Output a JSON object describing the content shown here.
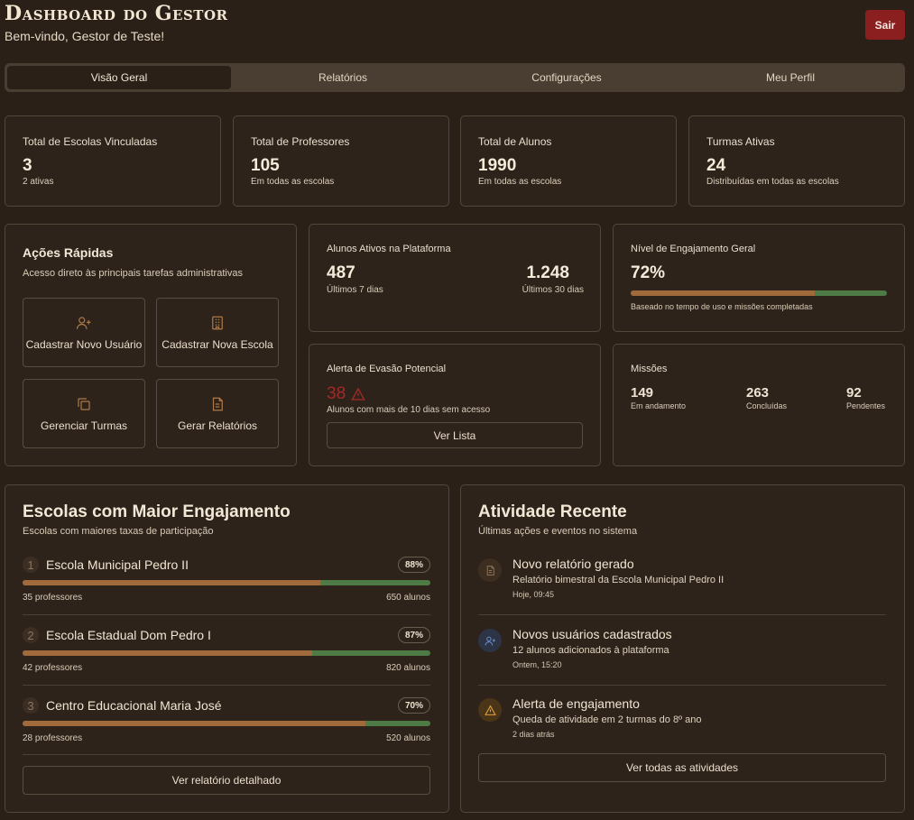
{
  "header": {
    "title": "Dashboard do Gestor",
    "subtitle": "Bem-vindo, Gestor de Teste!",
    "logout_label": "Sair"
  },
  "tabs": [
    {
      "label": "Visão Geral",
      "active": true
    },
    {
      "label": "Relatórios",
      "active": false
    },
    {
      "label": "Configurações",
      "active": false
    },
    {
      "label": "Meu Perfil",
      "active": false
    }
  ],
  "stats": [
    {
      "label": "Total de Escolas Vinculadas",
      "value": "3",
      "note": "2 ativas"
    },
    {
      "label": "Total de Professores",
      "value": "105",
      "note": "Em todas as escolas"
    },
    {
      "label": "Total de Alunos",
      "value": "1990",
      "note": "Em todas as escolas"
    },
    {
      "label": "Turmas Ativas",
      "value": "24",
      "note": "Distribuídas em todas as escolas"
    }
  ],
  "quick_actions": {
    "title": "Ações Rápidas",
    "subtitle": "Acesso direto às principais tarefas administrativas",
    "items": [
      {
        "label": "Cadastrar Novo Usuário",
        "icon": "user-plus-icon"
      },
      {
        "label": "Cadastrar Nova Escola",
        "icon": "building-icon"
      },
      {
        "label": "Gerenciar Turmas",
        "icon": "copy-icon"
      },
      {
        "label": "Gerar Relatórios",
        "icon": "document-icon"
      }
    ]
  },
  "active_students": {
    "title": "Alunos Ativos na Plataforma",
    "value_7": "487",
    "label_7": "Últimos 7 dias",
    "value_30": "1.248",
    "label_30": "Últimos 30 dias"
  },
  "engagement": {
    "title": "Nível de Engajamento Geral",
    "value": "72%",
    "level": 0.72,
    "note": "Baseado no tempo de uso e missões completadas"
  },
  "dropout": {
    "title": "Alerta de Evasão Potencial",
    "value": "38",
    "note": "Alunos com mais de 10 dias sem acesso",
    "button": "Ver Lista"
  },
  "missions": {
    "title": "Missões",
    "items": [
      {
        "value": "149",
        "label": "Em andamento"
      },
      {
        "value": "263",
        "label": "Concluídas"
      },
      {
        "value": "92",
        "label": "Pendentes"
      }
    ]
  },
  "top_schools": {
    "title": "Escolas com Maior Engajamento",
    "subtitle": "Escolas com maiores taxas de participação",
    "items": [
      {
        "rank": "1",
        "name": "Escola Municipal Pedro II",
        "pct": "88%",
        "level": 0.73,
        "teachers": "35 professores",
        "students": "650 alunos"
      },
      {
        "rank": "2",
        "name": "Escola Estadual Dom Pedro I",
        "pct": "87%",
        "level": 0.71,
        "teachers": "42 professores",
        "students": "820 alunos"
      },
      {
        "rank": "3",
        "name": "Centro Educacional Maria José",
        "pct": "70%",
        "level": 0.84,
        "teachers": "28 professores",
        "students": "520 alunos"
      }
    ],
    "button": "Ver relatório detalhado"
  },
  "recent": {
    "title": "Atividade Recente",
    "subtitle": "Últimas ações e eventos no sistema",
    "items": [
      {
        "title": "Novo relatório gerado",
        "desc": "Relatório bimestral da Escola Municipal Pedro II",
        "time": "Hoje, 09:45",
        "icon": "document-icon"
      },
      {
        "title": "Novos usuários cadastrados",
        "desc": "12 alunos adicionados à plataforma",
        "time": "Ontem, 15:20",
        "icon": "user-plus-icon"
      },
      {
        "title": "Alerta de engajamento",
        "desc": "Queda de atividade em 2 turmas do 8º ano",
        "time": "2 dias atrás",
        "icon": "warning-icon"
      }
    ],
    "button": "Ver todas as atividades"
  },
  "colors": {
    "accent": "#a06a3a",
    "progress_track": "#4e7a45",
    "danger": "#8b1e1e",
    "alert_red": "#a32a26"
  }
}
